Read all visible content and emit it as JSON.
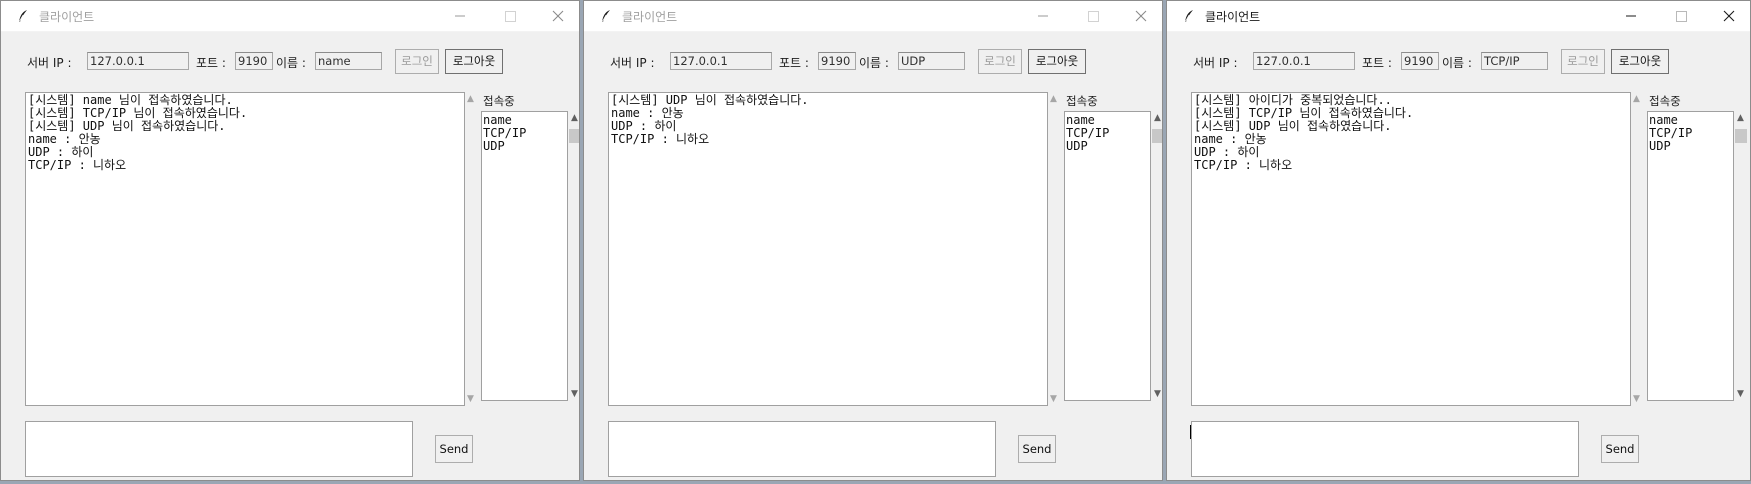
{
  "windows": [
    {
      "title": "클라이언트",
      "server_ip_label": "서버 IP :",
      "server_ip_value": "127.0.0.1",
      "port_label": "포트 :",
      "port_value": "9190",
      "name_label": "이름 :",
      "name_value": "name",
      "login_label": "로그인",
      "logout_label": "로그아웃",
      "chat_lines": [
        "[시스템] name 님이 접속하였습니다.",
        "[시스템] TCP/IP 님이 접속하였습니다.",
        "[시스템] UDP 님이 접속하였습니다.",
        "name : 안농",
        "UDP : 하이",
        "TCP/IP : 니하오"
      ],
      "users_label": "접속중",
      "users": [
        "name",
        "TCP/IP",
        "UDP"
      ],
      "send_label": "Send"
    },
    {
      "title": "클라이언트",
      "server_ip_label": "서버 IP :",
      "server_ip_value": "127.0.0.1",
      "port_label": "포트 :",
      "port_value": "9190",
      "name_label": "이름 :",
      "name_value": "UDP",
      "login_label": "로그인",
      "logout_label": "로그아웃",
      "chat_lines": [
        "[시스템] UDP 님이 접속하였습니다.",
        "name : 안농",
        "UDP : 하이",
        "TCP/IP : 니하오"
      ],
      "users_label": "접속중",
      "users": [
        "name",
        "TCP/IP",
        "UDP"
      ],
      "send_label": "Send"
    },
    {
      "title": "클라이언트",
      "server_ip_label": "서버 IP :",
      "server_ip_value": "127.0.0.1",
      "port_label": "포트 :",
      "port_value": "9190",
      "name_label": "이름 :",
      "name_value": "TCP/IP",
      "login_label": "로그인",
      "logout_label": "로그아웃",
      "chat_lines": [
        "[시스템] 아이디가 중복되었습니다..",
        "[시스템] TCP/IP 님이 접속하였습니다.",
        "[시스템] UDP 님이 접속하였습니다.",
        "name : 안농",
        "UDP : 하이",
        "TCP/IP : 니하오"
      ],
      "users_label": "접속중",
      "users": [
        "name",
        "TCP/IP",
        "UDP"
      ],
      "send_label": "Send"
    }
  ],
  "icons": {
    "app": "feather-icon",
    "minimize": "minimize-icon",
    "maximize": "maximize-icon",
    "close": "close-icon"
  },
  "colors": {
    "window_bg": "#f0f0f0",
    "desktop_bg": "#9aa6b4",
    "inactive_text": "#a0a0a0"
  }
}
